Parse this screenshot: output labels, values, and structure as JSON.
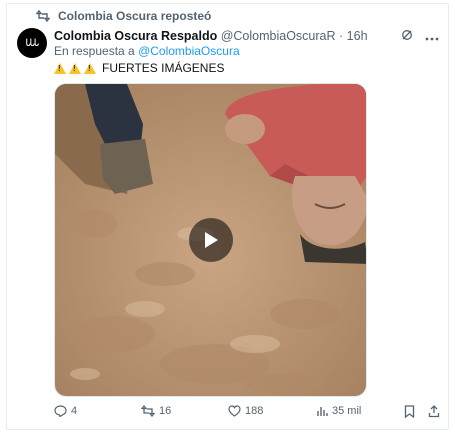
{
  "repost": {
    "label": "Colombia Oscura reposteó"
  },
  "author": {
    "name": "Colombia Oscura Respaldo",
    "handle": "@ColombiaOscuraR",
    "separator": "·",
    "time": "16h",
    "avatar_text": "ᏓᏓᏓ"
  },
  "reply": {
    "prefix": "En respuesta a",
    "handle": "@ColombiaOscura"
  },
  "tweet": {
    "text": "FUERTES IMÁGENES",
    "warning_icons": [
      "warning-icon",
      "warning-icon",
      "warning-icon"
    ]
  },
  "media": {
    "type": "video"
  },
  "actions": {
    "replies": "4",
    "reposts": "16",
    "likes": "188",
    "views": "35 mil"
  },
  "colors": {
    "link": "#1d9bf0",
    "muted": "#536471",
    "text": "#0f1419",
    "warning": "#f7c325"
  }
}
